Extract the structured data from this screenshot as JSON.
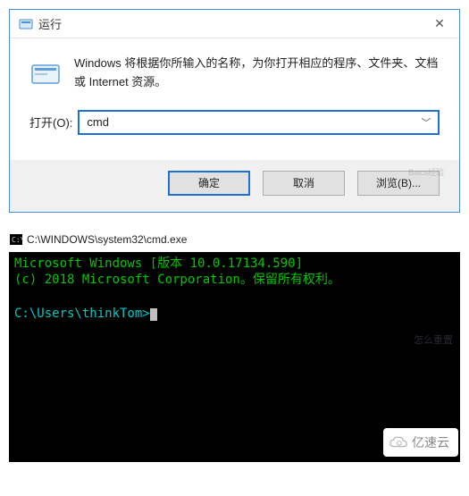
{
  "run_dialog": {
    "title": "运行",
    "description": "Windows 将根据你所输入的名称，为你打开相应的程序、文件夹、文档或 Internet 资源。",
    "open_label": "打开(O):",
    "input_value": "cmd",
    "buttons": {
      "ok": "确定",
      "cancel": "取消",
      "browse": "浏览(B)..."
    },
    "watermark": "Baics经验"
  },
  "cmd_window": {
    "title": "C:\\WINDOWS\\system32\\cmd.exe",
    "line1": "Microsoft Windows [版本 10.0.17134.590]",
    "line2": "(c) 2018 Microsoft Corporation。保留所有权利。",
    "prompt": "C:\\Users\\thinkTom>",
    "watermark": "怎么重置"
  },
  "badge": {
    "text": "亿速云"
  }
}
